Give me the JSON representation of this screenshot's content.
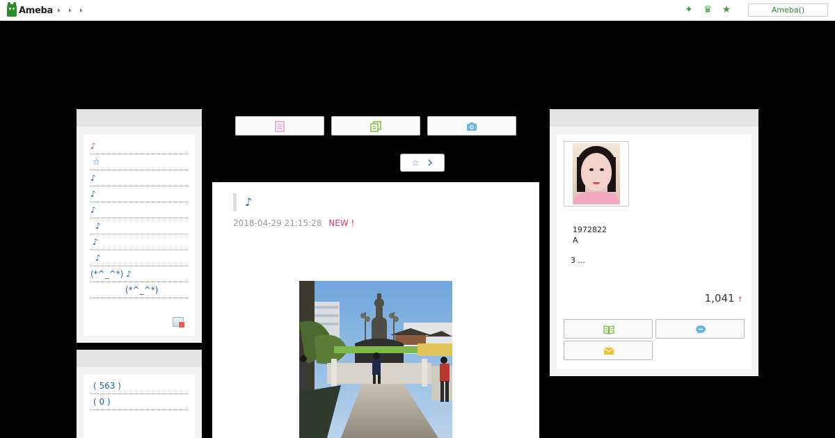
{
  "header": {
    "brand": "Ameba",
    "search_label": "Ameba()"
  },
  "colors": {
    "accent_green": "#2d8a2d",
    "link_blue": "#1a66aa",
    "pink": "#d63d9a"
  },
  "toolbar": {
    "buttons": [
      "memo-icon",
      "copy-icon",
      "camera-icon"
    ],
    "star_label": "☆"
  },
  "sidebar_theme": {
    "items": [
      "♪",
      "☆",
      "♪",
      "♪",
      "♪",
      "♪",
      "♪",
      "♪",
      "(*^_^*) ♪",
      "(*^_^*)"
    ]
  },
  "sidebar_archive": {
    "items": [
      "( 563 )",
      "( 0 )"
    ]
  },
  "article": {
    "title": "♪",
    "date": "2018-04-29 21:15:28",
    "new_label": "NEW !"
  },
  "profile": {
    "id_line": "1972822",
    "blood_line": "A",
    "summary": "3 ...",
    "readers": "1,041",
    "readers_arrow": "↑",
    "buttons": [
      "book-icon",
      "chat-icon",
      "mail-icon"
    ]
  }
}
